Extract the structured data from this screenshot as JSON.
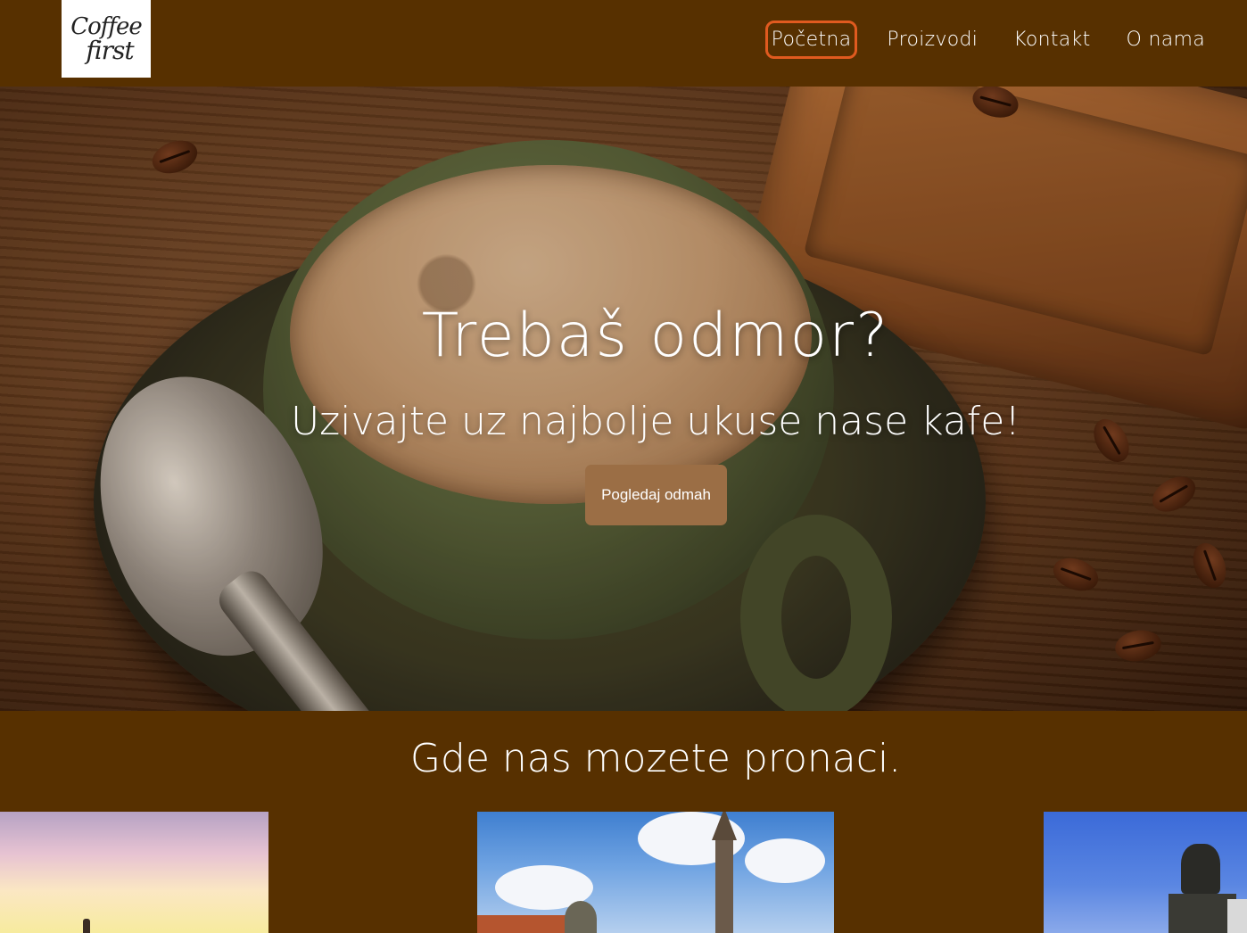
{
  "header": {
    "logo_line1": "Coffee",
    "logo_line2": "first",
    "nav": [
      {
        "label": "Početna",
        "active": true
      },
      {
        "label": "Proizvodi",
        "active": false
      },
      {
        "label": "Kontakt",
        "active": false
      },
      {
        "label": "O nama",
        "active": false
      }
    ]
  },
  "hero": {
    "title": "Trebaš odmor?",
    "subtitle": "Uzivajte uz najbolje ukuse nase kafe!",
    "button_label": "Pogledaj odmah"
  },
  "locations": {
    "title": "Gde nas mozete pronaci."
  },
  "colors": {
    "background": "#573000",
    "active_nav_border": "#e05a1f",
    "button": "#9b6e45"
  }
}
